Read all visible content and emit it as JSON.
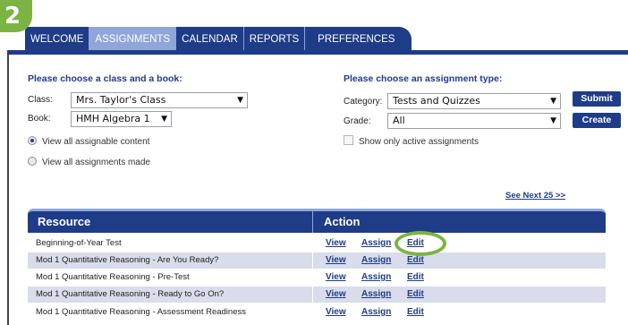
{
  "step_badge": "2",
  "tabs": [
    {
      "label": "WELCOME",
      "active": false
    },
    {
      "label": "ASSIGNMENTS",
      "active": true
    },
    {
      "label": "CALENDAR",
      "active": false
    },
    {
      "label": "REPORTS",
      "active": false
    },
    {
      "label": "PREFERENCES",
      "active": false
    }
  ],
  "left_panel": {
    "heading": "Please choose a class and a book:",
    "class_label": "Class:",
    "class_value": "Mrs. Taylor's Class",
    "book_label": "Book:",
    "book_value": "HMH Algebra 1",
    "radio_all_content": "View all assignable content",
    "radio_all_made": "View all assignments made"
  },
  "right_panel": {
    "heading": "Please choose an assignment type:",
    "category_label": "Category:",
    "category_value": "Tests and Quizzes",
    "grade_label": "Grade:",
    "grade_value": "All",
    "active_only": "Show only active assignments",
    "submit_label": "Submit",
    "create_label": "Create"
  },
  "see_next": "See Next 25 >>",
  "table": {
    "col_resource": "Resource",
    "col_action": "Action",
    "link_view": "View",
    "link_assign": "Assign",
    "link_edit": "Edit",
    "rows": [
      "Beginning-of-Year Test",
      "Mod 1 Quantitative Reasoning - Are You Ready?",
      "Mod 1 Quantitative Reasoning - Pre-Test",
      "Mod 1 Quantitative Reasoning - Ready to Go On?",
      "Mod 1 Quantitative Reasoning - Assessment Readiness"
    ]
  },
  "colors": {
    "primary": "#1f3c88",
    "tab_active": "#8fa6da",
    "highlight": "#7cb342",
    "row_alt": "#d9dcea"
  }
}
